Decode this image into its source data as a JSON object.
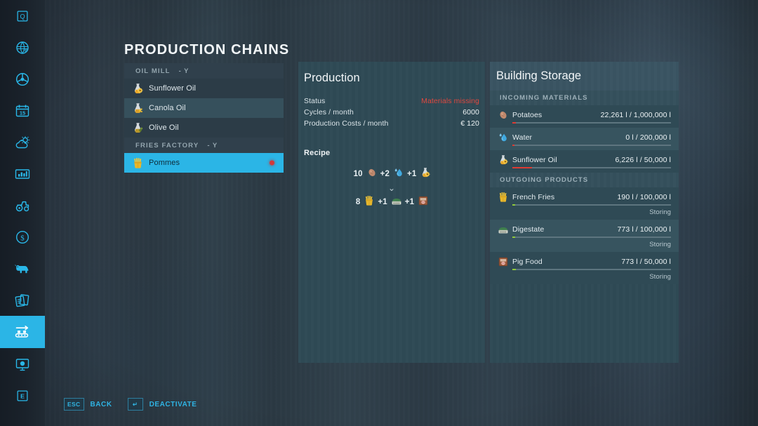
{
  "sidebar": {
    "items": [
      {
        "name": "help-q-icon",
        "glyph": "Q",
        "active": false
      },
      {
        "name": "globe-icon",
        "glyph": "globe",
        "active": false
      },
      {
        "name": "steering-wheel-icon",
        "glyph": "wheel",
        "active": false
      },
      {
        "name": "calendar-icon",
        "glyph": "calendar",
        "label": "15",
        "active": false
      },
      {
        "name": "weather-icon",
        "glyph": "weather",
        "active": false
      },
      {
        "name": "statistics-icon",
        "glyph": "chart",
        "active": false
      },
      {
        "name": "vehicles-icon",
        "glyph": "tractor",
        "active": false
      },
      {
        "name": "finances-icon",
        "glyph": "dollar",
        "active": false
      },
      {
        "name": "animals-icon",
        "glyph": "cow",
        "active": false
      },
      {
        "name": "contracts-icon",
        "glyph": "papers",
        "active": false
      },
      {
        "name": "production-chains-icon",
        "glyph": "conveyor",
        "active": true
      },
      {
        "name": "ai-worker-icon",
        "glyph": "monitor",
        "active": false
      },
      {
        "name": "controls-icon",
        "glyph": "E",
        "active": false
      }
    ]
  },
  "page": {
    "title": "PRODUCTION CHAINS"
  },
  "chain_list": {
    "groups": [
      {
        "header": "OIL MILL",
        "header_key": "-  Y",
        "items": [
          {
            "label": "Sunflower Oil",
            "icon": "sunflower-oil-icon",
            "selected": false,
            "alt": false,
            "dot": null
          },
          {
            "label": "Canola Oil",
            "icon": "canola-oil-icon",
            "selected": false,
            "alt": true,
            "dot": null
          },
          {
            "label": "Olive Oil",
            "icon": "olive-oil-icon",
            "selected": false,
            "alt": false,
            "dot": null
          }
        ]
      },
      {
        "header": "FRIES FACTORY",
        "header_key": "-  Y",
        "items": [
          {
            "label": "Pommes",
            "icon": "french-fries-icon",
            "selected": true,
            "alt": false,
            "dot": "#d23a3a"
          }
        ]
      }
    ]
  },
  "production": {
    "title": "Production",
    "rows": [
      {
        "label": "Status",
        "value": "Materials missing",
        "warn": true
      },
      {
        "label": "Cycles / month",
        "value": "6000",
        "warn": false
      },
      {
        "label": "Production Costs / month",
        "value": "€ 120",
        "warn": false
      }
    ],
    "recipe_title": "Recipe",
    "recipe": {
      "inputs": [
        {
          "amount": "10",
          "icon": "potato-icon"
        },
        {
          "amount": "+2",
          "icon": "water-drop-icon"
        },
        {
          "amount": "+1",
          "icon": "sunflower-oil-icon"
        }
      ],
      "arrow": "⌄",
      "outputs": [
        {
          "amount": "8",
          "icon": "french-fries-icon"
        },
        {
          "amount": "+1",
          "icon": "digestate-icon"
        },
        {
          "amount": "+1",
          "icon": "pig-food-icon"
        }
      ]
    }
  },
  "storage": {
    "title": "Building Storage",
    "sections": [
      {
        "header": "INCOMING MATERIALS",
        "items": [
          {
            "name": "Potatoes",
            "icon": "potato-icon",
            "amount": "22,261 l / 1,000,000 l",
            "fill_pct": 2.2,
            "bar_color": "red",
            "status": null,
            "alt": false
          },
          {
            "name": "Water",
            "icon": "water-drop-icon",
            "amount": "0 l / 200,000 l",
            "fill_pct": 1.2,
            "bar_color": "red",
            "status": null,
            "alt": true
          },
          {
            "name": "Sunflower Oil",
            "icon": "sunflower-oil-icon",
            "amount": "6,226 l / 50,000 l",
            "fill_pct": 12.5,
            "bar_color": "red",
            "status": null,
            "alt": false
          }
        ]
      },
      {
        "header": "OUTGOING PRODUCTS",
        "items": [
          {
            "name": "French Fries",
            "icon": "french-fries-icon",
            "amount": "190 l / 100,000 l",
            "fill_pct": 1.6,
            "bar_color": "green",
            "status": "Storing",
            "alt": false
          },
          {
            "name": "Digestate",
            "icon": "digestate-icon",
            "amount": "773 l / 100,000 l",
            "fill_pct": 1.6,
            "bar_color": "green",
            "status": "Storing",
            "alt": true
          },
          {
            "name": "Pig Food",
            "icon": "pig-food-icon",
            "amount": "773 l / 50,000 l",
            "fill_pct": 2.0,
            "bar_color": "green",
            "status": "Storing",
            "alt": false
          }
        ]
      }
    ]
  },
  "helpbar": {
    "items": [
      {
        "key": "ESC",
        "label": "BACK"
      },
      {
        "key": "↵",
        "label": "DEACTIVATE"
      }
    ]
  },
  "colors": {
    "accent": "#2bb5e6",
    "panel": "#2f4a55",
    "warn": "#e0473f",
    "ok": "#8fc93a"
  }
}
